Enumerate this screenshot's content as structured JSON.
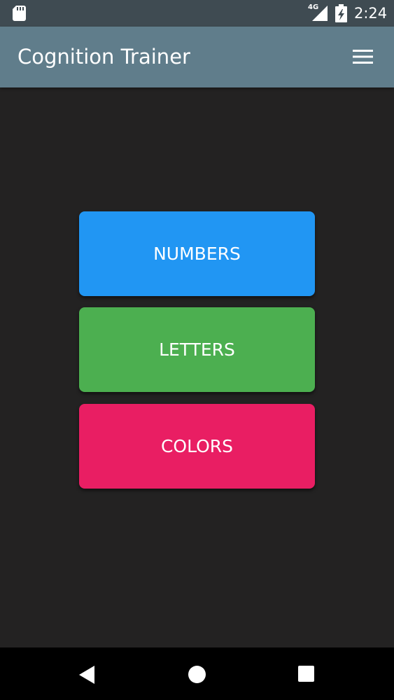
{
  "status_bar": {
    "network_type": "4G",
    "time": "2:24"
  },
  "app_bar": {
    "title": "Cognition Trainer",
    "menu_icon": "hamburger-menu-icon"
  },
  "modes": {
    "numbers": {
      "label": "NUMBERS",
      "color": "#2196f3"
    },
    "letters": {
      "label": "LETTERS",
      "color": "#4caf50"
    },
    "colors": {
      "label": "COLORS",
      "color": "#e91e63"
    }
  },
  "nav_bar": {
    "back_icon": "back-triangle-icon",
    "home_icon": "home-circle-icon",
    "recents_icon": "recents-square-icon"
  },
  "theme": {
    "app_bar_color": "#607d8b",
    "background_color": "#232222"
  }
}
